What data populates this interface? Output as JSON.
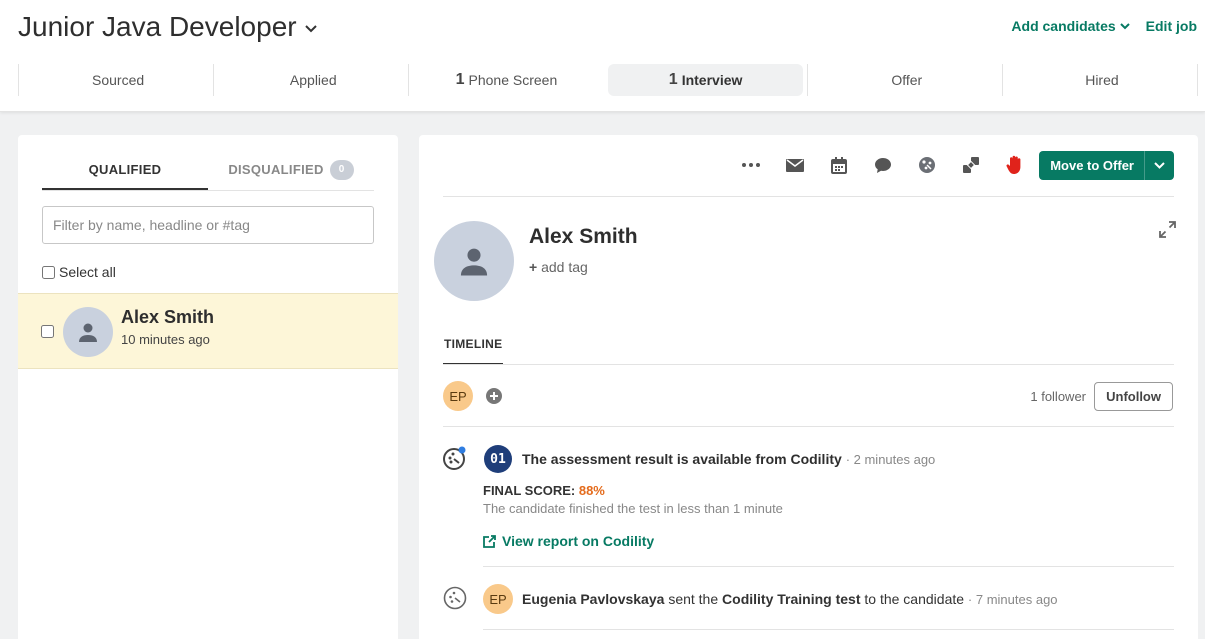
{
  "header": {
    "job_title": "Junior Java Developer",
    "add_candidates": "Add candidates",
    "edit_job": "Edit job"
  },
  "stages": [
    {
      "label": "Sourced",
      "count": ""
    },
    {
      "label": "Applied",
      "count": ""
    },
    {
      "label": "Phone Screen",
      "count": "1"
    },
    {
      "label": "Interview",
      "count": "1"
    },
    {
      "label": "Offer",
      "count": ""
    },
    {
      "label": "Hired",
      "count": ""
    }
  ],
  "left_panel": {
    "tab_qualified": "QUALIFIED",
    "tab_disqualified": "DISQUALIFIED",
    "disqualified_count": "0",
    "filter_placeholder": "Filter by name, headline or #tag",
    "select_all": "Select all",
    "candidates": [
      {
        "name": "Alex Smith",
        "time": "10 minutes ago"
      }
    ]
  },
  "right_panel": {
    "move_button": "Move to Offer",
    "candidate_name": "Alex Smith",
    "add_tag": "add tag",
    "timeline_tab": "TIMELINE",
    "follower_initials": "EP",
    "followers_text": "1 follower",
    "unfollow": "Unfollow",
    "events": [
      {
        "badge": "01",
        "title": "The assessment result is available from Codility",
        "time": "· 2 minutes ago",
        "score_label": "FINAL SCORE:",
        "score_value": "88%",
        "note": "The candidate finished the test in less than 1 minute",
        "link": "View report on Codility"
      },
      {
        "initials": "EP",
        "actor": "Eugenia Pavlovskaya",
        "verb": "sent the",
        "object": "Codility Training test",
        "suffix": "to the candidate",
        "time": "· 7 minutes ago"
      }
    ]
  },
  "colors": {
    "accent": "#077a63",
    "score": "#e46b1c",
    "highlight_row": "#fdf6d8",
    "hand_icon": "#e0231b"
  }
}
